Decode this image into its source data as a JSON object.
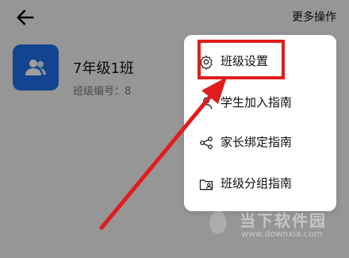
{
  "header": {
    "more_label": "更多操作"
  },
  "class_card": {
    "name": "7年级1班",
    "code_label": "班级编号：8"
  },
  "menu": {
    "items": [
      {
        "label": "班级设置",
        "icon": "gear-icon"
      },
      {
        "label": "学生加入指南",
        "icon": "user-icon"
      },
      {
        "label": "家长绑定指南",
        "icon": "share-icon"
      },
      {
        "label": "班级分组指南",
        "icon": "folder-user-icon"
      }
    ]
  },
  "watermark": {
    "text": "当下软件园",
    "url": "www.downxia.com"
  },
  "colors": {
    "accent_red": "#e01d1d",
    "avatar_blue": "#1f6fe8"
  }
}
